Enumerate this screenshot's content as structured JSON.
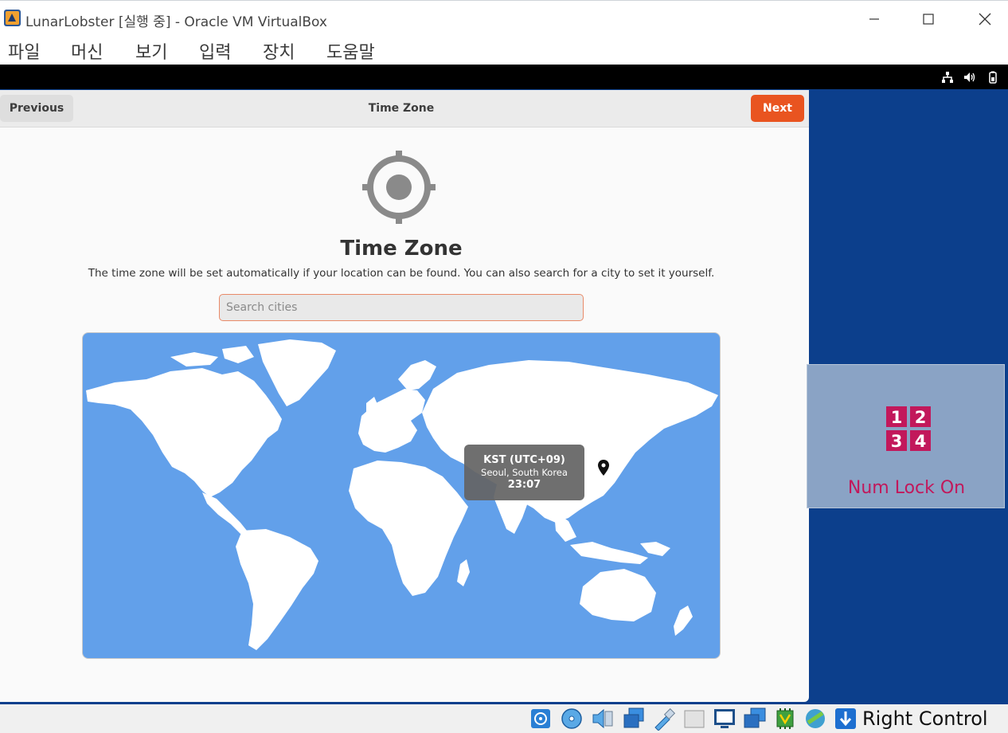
{
  "window": {
    "title": "LunarLobster [실행 중] - Oracle VM VirtualBox",
    "app_icon": "virtualbox-icon",
    "controls": [
      "minimize-icon",
      "maximize-icon",
      "close-icon"
    ]
  },
  "menu": {
    "items": [
      "파일",
      "머신",
      "보기",
      "입력",
      "장치",
      "도움말"
    ]
  },
  "guest_topbar": {
    "icons": [
      "network-icon",
      "volume-icon",
      "battery-icon"
    ]
  },
  "installer": {
    "previous_label": "Previous",
    "header_title": "Time Zone",
    "next_label": "Next",
    "accent_color": "#e95420",
    "icon": "location-target-icon",
    "page_title": "Time Zone",
    "description": "The time zone will be set automatically if your location can be found. You can also search for a city to set it yourself.",
    "search": {
      "placeholder": "Search cities",
      "value": ""
    },
    "map": {
      "ocean_color": "#62a0ea",
      "land_color": "#ffffff",
      "tooltip": {
        "abbrev": "KST (UTC+09)",
        "city": "Seoul, South Korea",
        "time": "23:07"
      },
      "pin_icon": "map-pin-icon"
    }
  },
  "osd": {
    "icon": "numlock-icon",
    "icon_digits": [
      "1",
      "2",
      "3",
      "4"
    ],
    "label": "Num Lock On",
    "label_color": "#c2185b"
  },
  "statusbar": {
    "icons": [
      "hard-disk-icon",
      "optical-drive-icon",
      "audio-icon",
      "network-adapter-icon",
      "usb-icon",
      "shared-folder-icon",
      "display-icon",
      "recording-icon",
      "cpu-icon",
      "mouse-integration-icon",
      "keyboard-capture-icon"
    ],
    "host_key": "Right Control"
  }
}
